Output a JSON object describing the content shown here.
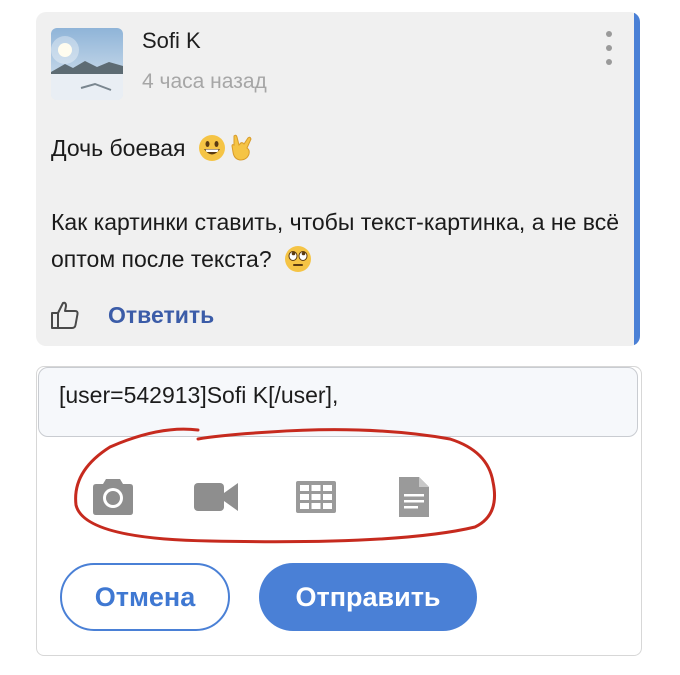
{
  "comment": {
    "author": "Sofi K",
    "time": "4 часа назад",
    "line1": "Дочь боевая",
    "line2": "Как картинки ставить, чтобы текст-картинка, а не всё оптом после текста?",
    "reply_label": "Ответить",
    "accent_color": "#4a80d6",
    "icons": [
      "avatar-photo",
      "more-vertical-icon",
      "grinning-emoji",
      "rock-hand-emoji",
      "eye-roll-emoji",
      "thumbs-up-icon"
    ]
  },
  "reply": {
    "input_value": "[user=542913]Sofi K[/user],",
    "toolbar_icons": [
      "camera-icon",
      "video-icon",
      "table-icon",
      "document-icon"
    ],
    "cancel_label": "Отмена",
    "send_label": "Отправить",
    "button_color": "#4a80d6",
    "annotation_color": "#c62a1e"
  }
}
